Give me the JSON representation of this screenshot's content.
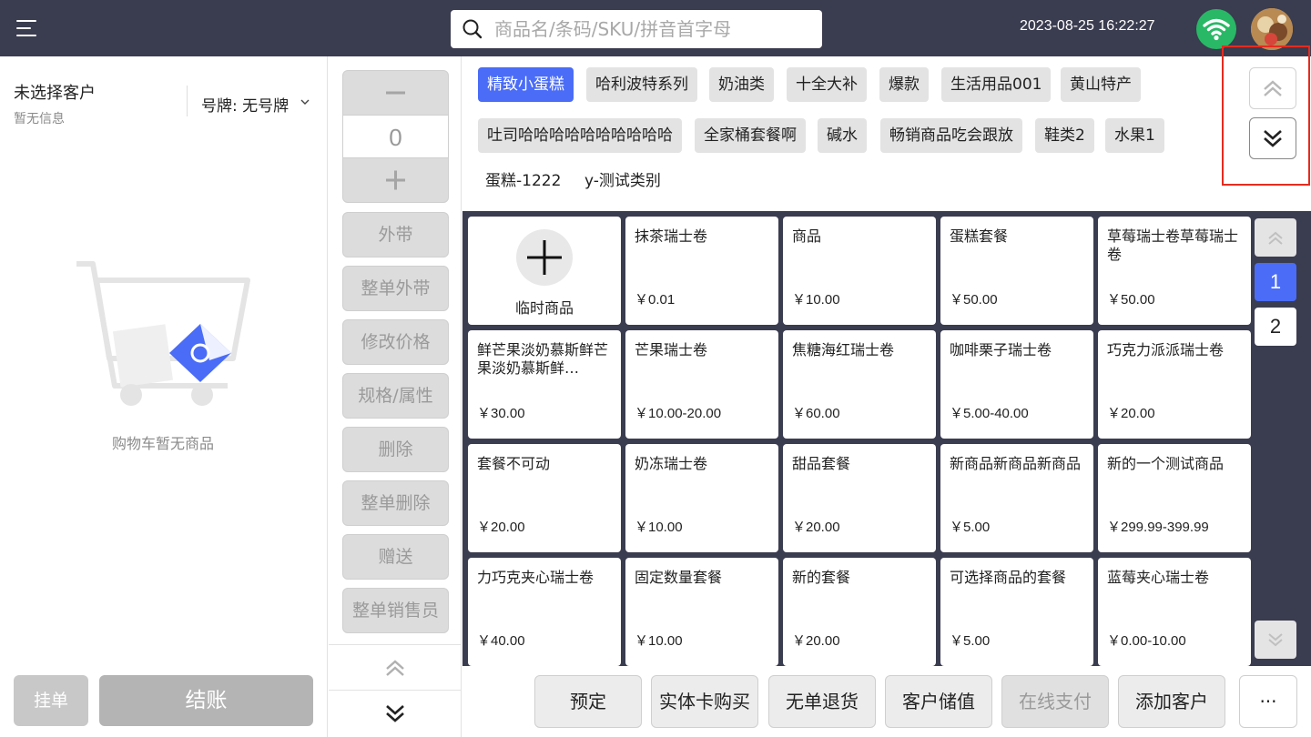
{
  "header": {
    "search_placeholder": "商品名/条码/SKU/拼音首字母",
    "datetime": "2023-08-25 16:22:27"
  },
  "customer": {
    "name": "未选择客户",
    "info": "暂无信息",
    "plate": "号牌:  无号牌"
  },
  "cart": {
    "empty_text": "购物车暂无商品",
    "hold_label": "挂单",
    "checkout_label": "结账"
  },
  "ops": {
    "quantity": "0",
    "minus": "−",
    "plus": "+",
    "buttons": [
      "外带",
      "整单外带",
      "修改价格",
      "规格/属性",
      "删除",
      "整单删除",
      "赠送",
      "整单销售员"
    ]
  },
  "categories": [
    "精致小蛋糕",
    "哈利波特系列",
    "奶油类",
    "十全大补",
    "爆款",
    "生活用品001",
    "黄山特产",
    "吐司哈哈哈哈哈哈哈哈哈哈",
    "全家桶套餐啊",
    "碱水",
    "畅销商品吃会跟放",
    "鞋类2",
    "水果1",
    "蛋糕-1222",
    "y-测试类别"
  ],
  "products": {
    "temp_label": "临时商品",
    "items": [
      {
        "name": "抹茶瑞士卷",
        "price": "￥0.01"
      },
      {
        "name": "商品",
        "price": "￥10.00"
      },
      {
        "name": "蛋糕套餐",
        "price": "￥50.00"
      },
      {
        "name": "草莓瑞士卷草莓瑞士卷",
        "price": "￥50.00"
      },
      {
        "name": "鲜芒果淡奶慕斯鲜芒果淡奶慕斯鲜…",
        "price": "￥30.00"
      },
      {
        "name": "芒果瑞士卷",
        "price": "￥10.00-20.00"
      },
      {
        "name": "焦糖海红瑞士卷",
        "price": "￥60.00"
      },
      {
        "name": "咖啡栗子瑞士卷",
        "price": "￥5.00-40.00"
      },
      {
        "name": "巧克力派派瑞士卷",
        "price": "￥20.00"
      },
      {
        "name": "套餐不可动",
        "price": "￥20.00"
      },
      {
        "name": "奶冻瑞士卷",
        "price": "￥10.00"
      },
      {
        "name": "甜品套餐",
        "price": "￥20.00"
      },
      {
        "name": "新商品新商品新商品",
        "price": "￥5.00"
      },
      {
        "name": "新的一个测试商品",
        "price": "￥299.99-399.99"
      },
      {
        "name": "力巧克夹心瑞士卷",
        "price": "￥40.00"
      },
      {
        "name": "固定数量套餐",
        "price": "￥10.00"
      },
      {
        "name": "新的套餐",
        "price": "￥20.00"
      },
      {
        "name": "可选择商品的套餐",
        "price": "￥5.00"
      },
      {
        "name": "蓝莓夹心瑞士卷",
        "price": "￥0.00-10.00"
      }
    ]
  },
  "pager": {
    "pages": [
      "1",
      "2"
    ],
    "current": 1
  },
  "actions": [
    {
      "label": "预定",
      "disabled": false
    },
    {
      "label": "实体卡购买",
      "disabled": false
    },
    {
      "label": "无单退货",
      "disabled": false
    },
    {
      "label": "客户储值",
      "disabled": false
    },
    {
      "label": "在线支付",
      "disabled": true
    },
    {
      "label": "添加客户",
      "disabled": false
    },
    {
      "label": "···",
      "disabled": false
    }
  ],
  "colors": {
    "topbar": "#3a3c4f",
    "accent": "#4a6cf7",
    "wifi": "#29b866",
    "highlight": "#e52b1f"
  },
  "icons": {
    "menu": "menu-icon",
    "search": "search-icon",
    "wifi": "wifi-icon",
    "avatar": "avatar-image",
    "cart": "cart-icon",
    "plus": "plus-icon",
    "double_up": "double-chevron-up-icon",
    "double_down": "double-chevron-down-icon"
  }
}
